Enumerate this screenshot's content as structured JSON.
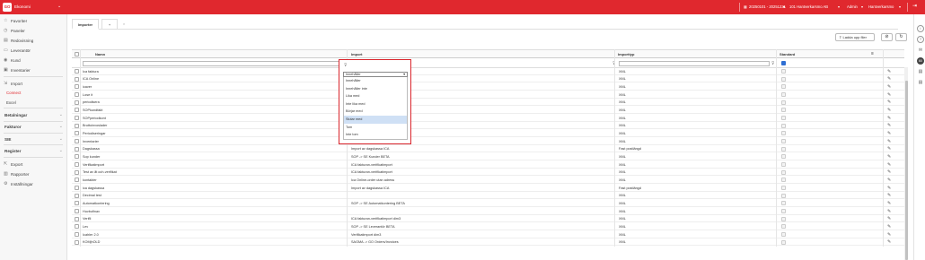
{
  "topbar": {
    "logo": "GO",
    "app_title": "Ekonomi",
    "period": "20250101 - 20251231",
    "company": "101 Hantverkarsmo AB",
    "role": "Admin",
    "user": "Hantverkarsmo"
  },
  "sidebar": {
    "items": [
      {
        "label": "Favoriter",
        "icon": "star-icon"
      },
      {
        "label": "Paneler",
        "icon": "dashboard-icon"
      },
      {
        "label": "Redovisning",
        "icon": "ledger-icon"
      },
      {
        "label": "Leverantör",
        "icon": "truck-icon"
      },
      {
        "label": "Kund",
        "icon": "user-icon"
      },
      {
        "label": "Inventarier",
        "icon": "box-icon"
      },
      {
        "label": "Import",
        "icon": "import-icon"
      }
    ],
    "import_sub": [
      {
        "label": "Connect",
        "active": true
      },
      {
        "label": "Excel",
        "active": false
      }
    ],
    "groups": [
      {
        "label": "Betalningar"
      },
      {
        "label": "Fakturor"
      },
      {
        "label": "SIE"
      },
      {
        "label": "Register"
      }
    ],
    "bottom": [
      {
        "label": "Export",
        "icon": "export-icon"
      },
      {
        "label": "Rapporter",
        "icon": "report-icon"
      },
      {
        "label": "Inställningar",
        "icon": "settings-icon"
      }
    ]
  },
  "tabs": [
    {
      "label": "Importer"
    },
    {
      "label": "+"
    },
    {
      "label": "×"
    }
  ],
  "toolbar": {
    "add_label": "Ladda upp filer"
  },
  "grid": {
    "columns": [
      "Namn",
      "Import",
      "Importtyp",
      "Standard"
    ],
    "rows": [
      {
        "name": "Ica faktura",
        "import": "",
        "type": "XML"
      },
      {
        "name": "ICA Online",
        "import": "",
        "type": "XML"
      },
      {
        "name": "icaver",
        "import": "",
        "type": "XML"
      },
      {
        "name": "Lose it",
        "import": "",
        "type": "XML"
      },
      {
        "name": "periodisera",
        "import": "",
        "type": "XML"
      },
      {
        "name": "SOPkundfakt",
        "import": "",
        "type": "XML"
      },
      {
        "name": "SOPperiodkont",
        "import": "",
        "type": "XML"
      },
      {
        "name": "Bruttoinvoslader",
        "import": "",
        "type": "XML"
      },
      {
        "name": "Periodiseringar",
        "import": "",
        "type": "XML"
      },
      {
        "name": "Inventarier",
        "import": "SOP -> SE Inventarier BETA",
        "type": "XML"
      },
      {
        "name": "Dagskassa",
        "import": "Import av dagskassa ICA",
        "type": "Fast postlängd"
      },
      {
        "name": "Sop kunder",
        "import": "SOP -> SE Kunder BETA",
        "type": "XML"
      },
      {
        "name": "Verifikatimport",
        "import": "ICA fakturan-verifikatimport",
        "type": "XML"
      },
      {
        "name": "Test av åt och-verifikat",
        "import": "ICA fakturan-verifikatimport",
        "type": "XML"
      },
      {
        "name": "kontakter",
        "import": "Ica Online-order utan adress",
        "type": "XML"
      },
      {
        "name": "ica dagskassa",
        "import": "Import av dagskassa ICA",
        "type": "Fast postlängd"
      },
      {
        "name": "Decimal test",
        "import": "",
        "type": "XML"
      },
      {
        "name": "Automatkontering",
        "import": "SOP -> SE Automatkontering BETA",
        "type": "XML"
      },
      {
        "name": "Huvbufinav",
        "import": "",
        "type": "XML"
      },
      {
        "name": "Verifli",
        "import": "ICA fakturan-verifikatimport dim3",
        "type": "XML"
      },
      {
        "name": "Lev",
        "import": "SOP -> SE Leverantör BETA",
        "type": "XML"
      },
      {
        "name": "Icahler 2.0",
        "import": "Verifikatimport dim3",
        "type": "XML"
      },
      {
        "name": "KOMjhOLD",
        "import": "SAGMA -> GO Orders/Invoices",
        "type": "XML"
      }
    ]
  },
  "filter_dropdown": {
    "selected": "Innehåller",
    "options": [
      {
        "label": "Innehåller",
        "highlighted": false
      },
      {
        "label": "Innehåller inte",
        "highlighted": false
      },
      {
        "label": "Lika med",
        "highlighted": false
      },
      {
        "label": "Inte lika med",
        "highlighted": false
      },
      {
        "label": "Börjar med",
        "highlighted": false
      },
      {
        "label": "Slutar med",
        "highlighted": true
      },
      {
        "label": "Tom",
        "highlighted": false
      },
      {
        "label": "Inte tom",
        "highlighted": false
      }
    ]
  },
  "right_panel": {
    "icons": [
      "info-icon",
      "help-icon",
      "chat-icon",
      "notification-icon",
      "document-icon",
      "document-icon"
    ],
    "badge": "60"
  }
}
